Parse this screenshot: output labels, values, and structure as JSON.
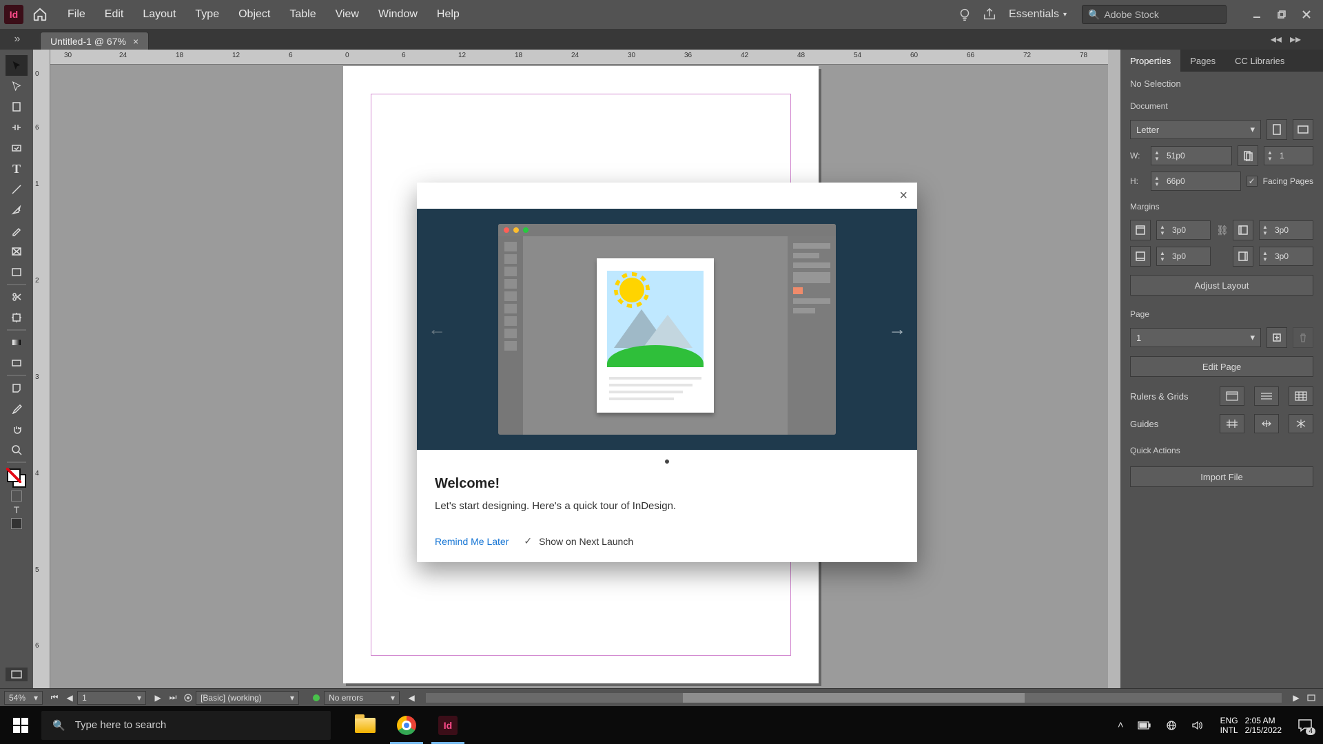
{
  "app_logo_text": "Id",
  "menu": {
    "file": "File",
    "edit": "Edit",
    "layout": "Layout",
    "type": "Type",
    "object": "Object",
    "table": "Table",
    "view": "View",
    "window": "Window",
    "help": "Help"
  },
  "workspace_label": "Essentials",
  "stock_placeholder": "Adobe Stock",
  "doc_tab": "Untitled-1 @ 67%",
  "hruler_ticks": [
    "30",
    "24",
    "18",
    "12",
    "6",
    "0",
    "6",
    "12",
    "18",
    "24",
    "30",
    "36",
    "42",
    "48",
    "54",
    "60",
    "66",
    "72",
    "78"
  ],
  "vruler_ticks": [
    "0",
    "6",
    "1",
    "2",
    "3",
    "4",
    "5",
    "6"
  ],
  "panel": {
    "tabs": {
      "properties": "Properties",
      "pages": "Pages",
      "cclib": "CC Libraries"
    },
    "no_selection": "No Selection",
    "document_label": "Document",
    "preset": "Letter",
    "w_label": "W:",
    "w_value": "51p0",
    "h_label": "H:",
    "h_value": "66p0",
    "pages_value": "1",
    "facing_pages": "Facing Pages",
    "margins_label": "Margins",
    "m_top": "3p0",
    "m_bottom": "3p0",
    "m_left": "3p0",
    "m_right": "3p0",
    "adjust_layout": "Adjust Layout",
    "page_label": "Page",
    "page_value": "1",
    "edit_page": "Edit Page",
    "rulers_label": "Rulers & Grids",
    "guides_label": "Guides",
    "quick_actions": "Quick Actions",
    "import_file": "Import File"
  },
  "status": {
    "zoom": "54%",
    "page": "1",
    "style": "[Basic] (working)",
    "errors": "No errors"
  },
  "modal": {
    "title": "Welcome!",
    "body": "Let's start designing. Here's a quick tour of InDesign.",
    "remind": "Remind Me Later",
    "show_on_launch": "Show on Next Launch"
  },
  "taskbar": {
    "search_placeholder": "Type here to search",
    "lang1": "ENG",
    "lang2": "INTL",
    "time": "2:05 AM",
    "date": "2/15/2022",
    "notif_count": "4"
  }
}
